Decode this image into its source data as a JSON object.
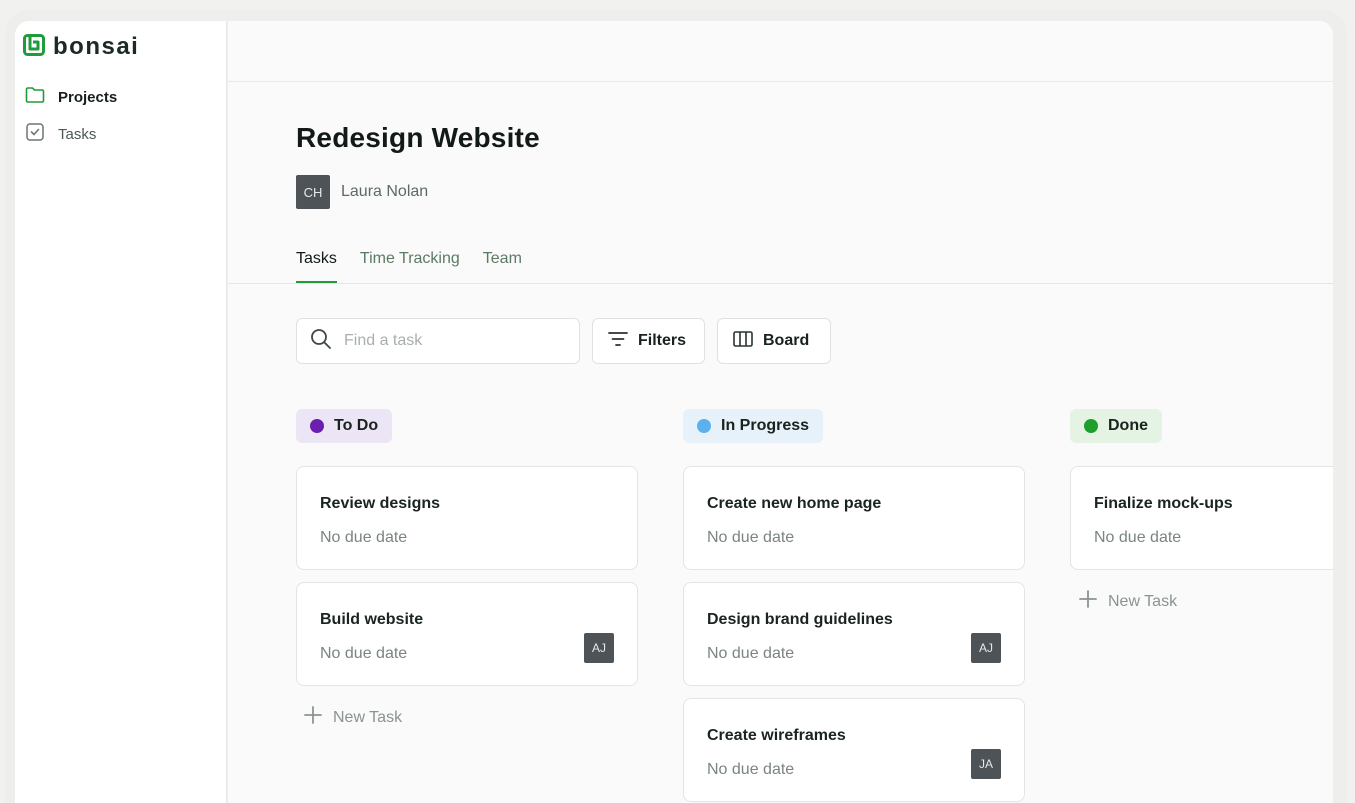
{
  "brand": {
    "name": "bonsai",
    "accent": "#1f9b3c"
  },
  "sidebar": {
    "items": [
      {
        "label": "Projects",
        "icon": "folder-icon"
      },
      {
        "label": "Tasks",
        "icon": "checkbox-icon"
      }
    ]
  },
  "project": {
    "title": "Redesign Website",
    "owner_initials": "CH",
    "owner_name": "Laura Nolan"
  },
  "tabs": [
    {
      "label": "Tasks",
      "active": true
    },
    {
      "label": "Time Tracking",
      "active": false
    },
    {
      "label": "Team",
      "active": false
    }
  ],
  "toolbar": {
    "search_placeholder": "Find a task",
    "filters_label": "Filters",
    "board_label": "Board"
  },
  "columns": [
    {
      "label": "To Do",
      "dot_color": "#6a1fb0",
      "bg_color": "#ece5f6",
      "cards": [
        {
          "title": "Review designs",
          "due": "No due date",
          "assignee": ""
        },
        {
          "title": "Build website",
          "due": "No due date",
          "assignee": "AJ"
        }
      ],
      "new_task_label": "New Task"
    },
    {
      "label": "In Progress",
      "dot_color": "#5bb0ee",
      "bg_color": "#e6f1fa",
      "cards": [
        {
          "title": "Create new home page",
          "due": "No due date",
          "assignee": ""
        },
        {
          "title": "Design brand guidelines",
          "due": "No due date",
          "assignee": "AJ"
        },
        {
          "title": "Create wireframes",
          "due": "No due date",
          "assignee": "JA"
        }
      ]
    },
    {
      "label": "Done",
      "dot_color": "#1e9e2a",
      "bg_color": "#e4f3e4",
      "cards": [
        {
          "title": "Finalize mock-ups",
          "due": "No due date",
          "assignee": ""
        }
      ],
      "new_task_label": "New Task"
    }
  ]
}
